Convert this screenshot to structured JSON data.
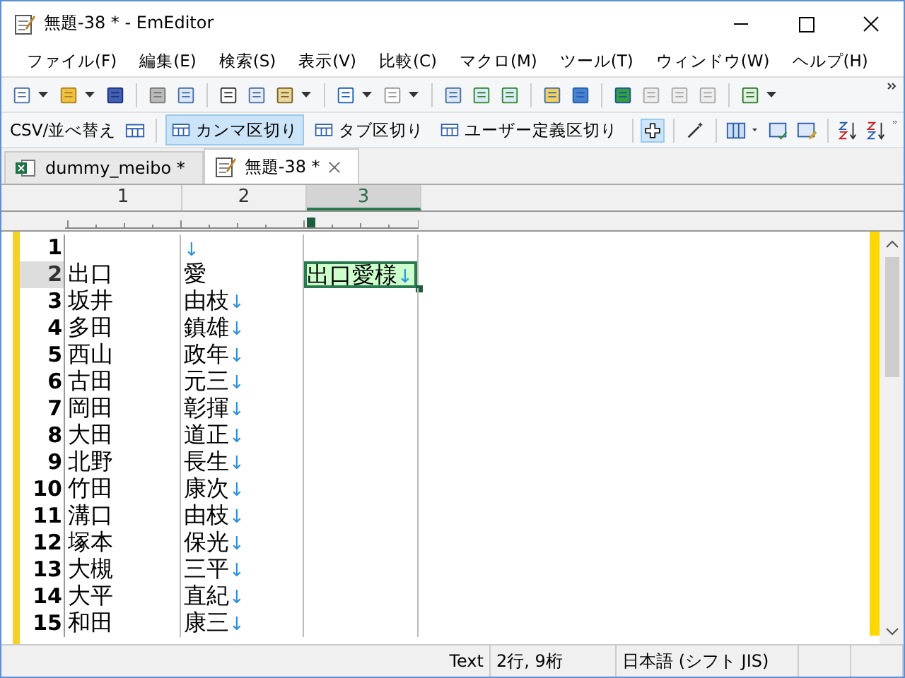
{
  "window": {
    "title": "無題-38 * - EmEditor"
  },
  "menu": [
    "ファイル(F)",
    "編集(E)",
    "検索(S)",
    "表示(V)",
    "比較(C)",
    "マクロ(M)",
    "ツール(T)",
    "ウィンドウ(W)",
    "ヘルプ(H)"
  ],
  "csv_toolbar": {
    "label": "CSV/並べ替え",
    "modes": [
      {
        "label": "カンマ区切り",
        "selected": true
      },
      {
        "label": "タブ区切り",
        "selected": false
      },
      {
        "label": "ユーザー定義区切り",
        "selected": false
      }
    ],
    "plus_tool_on": true
  },
  "tabs": [
    {
      "label": "dummy_meibo *",
      "kind": "sheet",
      "selected": false
    },
    {
      "label": "無題-38 *",
      "kind": "text",
      "selected": true
    }
  ],
  "columns": [
    {
      "label": "1",
      "selected": false
    },
    {
      "label": "2",
      "selected": false
    },
    {
      "label": "3",
      "selected": true
    }
  ],
  "rows": [
    {
      "number": "1",
      "current": false,
      "cells": [
        {},
        {
          "eol": "↓"
        },
        {}
      ]
    },
    {
      "number": "2",
      "current": true,
      "cells": [
        {
          "text": "出口"
        },
        {
          "text": "愛"
        },
        {
          "text": "出口愛様",
          "eol": "↓",
          "selected": true
        }
      ]
    },
    {
      "number": "3",
      "current": false,
      "cells": [
        {
          "text": "坂井"
        },
        {
          "text": "由枝",
          "eol": "↓"
        },
        {}
      ]
    },
    {
      "number": "4",
      "current": false,
      "cells": [
        {
          "text": "多田"
        },
        {
          "text": "鎮雄",
          "eol": "↓"
        },
        {}
      ]
    },
    {
      "number": "5",
      "current": false,
      "cells": [
        {
          "text": "西山"
        },
        {
          "text": "政年",
          "eol": "↓"
        },
        {}
      ]
    },
    {
      "number": "6",
      "current": false,
      "cells": [
        {
          "text": "古田"
        },
        {
          "text": "元三",
          "eol": "↓"
        },
        {}
      ]
    },
    {
      "number": "7",
      "current": false,
      "cells": [
        {
          "text": "岡田"
        },
        {
          "text": "彰揮",
          "eol": "↓"
        },
        {}
      ]
    },
    {
      "number": "8",
      "current": false,
      "cells": [
        {
          "text": "大田"
        },
        {
          "text": "道正",
          "eol": "↓"
        },
        {}
      ]
    },
    {
      "number": "9",
      "current": false,
      "cells": [
        {
          "text": "北野"
        },
        {
          "text": "長生",
          "eol": "↓"
        },
        {}
      ]
    },
    {
      "number": "10",
      "current": false,
      "cells": [
        {
          "text": "竹田"
        },
        {
          "text": "康次",
          "eol": "↓"
        },
        {}
      ]
    },
    {
      "number": "11",
      "current": false,
      "cells": [
        {
          "text": "溝口"
        },
        {
          "text": "由枝",
          "eol": "↓"
        },
        {}
      ]
    },
    {
      "number": "12",
      "current": false,
      "cells": [
        {
          "text": "塚本"
        },
        {
          "text": "保光",
          "eol": "↓"
        },
        {}
      ]
    },
    {
      "number": "13",
      "current": false,
      "cells": [
        {
          "text": "大槻"
        },
        {
          "text": "三平",
          "eol": "↓"
        },
        {}
      ]
    },
    {
      "number": "14",
      "current": false,
      "cells": [
        {
          "text": "大平"
        },
        {
          "text": "直紀",
          "eol": "↓"
        },
        {}
      ]
    },
    {
      "number": "15",
      "current": false,
      "cells": [
        {
          "text": "和田"
        },
        {
          "text": "康三",
          "eol": "↓"
        },
        {}
      ]
    }
  ],
  "status_bar": {
    "mode": "Text",
    "position": "2行, 9桁",
    "encoding": "日本語 (シフト JIS)"
  }
}
